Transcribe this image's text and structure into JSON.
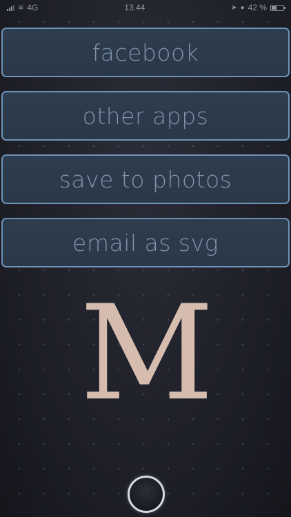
{
  "status_bar": {
    "carrier": "4G",
    "time": "13.44",
    "battery_percent": "42 %",
    "battery_level": 0.42,
    "icons": [
      "signal-icon",
      "wifi-icon",
      "location-icon",
      "alarm-icon",
      "battery-icon"
    ]
  },
  "buttons": [
    {
      "label": "facebook"
    },
    {
      "label": "other apps"
    },
    {
      "label": "save to photos"
    },
    {
      "label": "email as svg"
    }
  ],
  "monogram": {
    "letter": "M",
    "color": "#d6bcae"
  },
  "colors": {
    "button_border": "#6f93b7",
    "button_fill": "#2e3d4f",
    "button_text": "#7f93aa",
    "background": "#1e1f27"
  }
}
